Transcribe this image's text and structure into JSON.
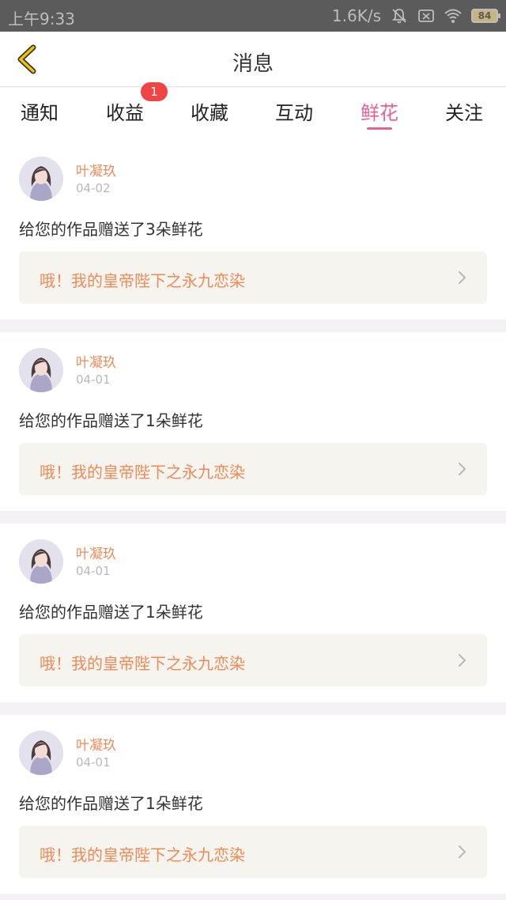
{
  "status_bar": {
    "time": "上午9:33",
    "net_speed": "1.6K/s",
    "battery": "84",
    "icons": [
      "mute-bell-icon",
      "sim-x-icon",
      "wifi-icon",
      "battery-icon"
    ]
  },
  "header": {
    "title": "消息",
    "back_icon": "chevron-left-icon",
    "accent_color": "#f2c300"
  },
  "tabs": [
    {
      "label": "通知",
      "active": false
    },
    {
      "label": "收益",
      "active": false,
      "badge": "1"
    },
    {
      "label": "收藏",
      "active": false
    },
    {
      "label": "互动",
      "active": false
    },
    {
      "label": "鲜花",
      "active": true
    },
    {
      "label": "关注",
      "active": false
    }
  ],
  "active_tab_color": "#ea5f94",
  "messages": [
    {
      "sender": "叶凝玖",
      "date": "04-02",
      "text": "给您的作品赠送了3朵鲜花",
      "work_title": "哦！我的皇帝陛下之永九恋染"
    },
    {
      "sender": "叶凝玖",
      "date": "04-01",
      "text": "给您的作品赠送了1朵鲜花",
      "work_title": "哦！我的皇帝陛下之永九恋染"
    },
    {
      "sender": "叶凝玖",
      "date": "04-01",
      "text": "给您的作品赠送了1朵鲜花",
      "work_title": "哦！我的皇帝陛下之永九恋染"
    },
    {
      "sender": "叶凝玖",
      "date": "04-01",
      "text": "给您的作品赠送了1朵鲜花",
      "work_title": "哦！我的皇帝陛下之永九恋染"
    }
  ]
}
